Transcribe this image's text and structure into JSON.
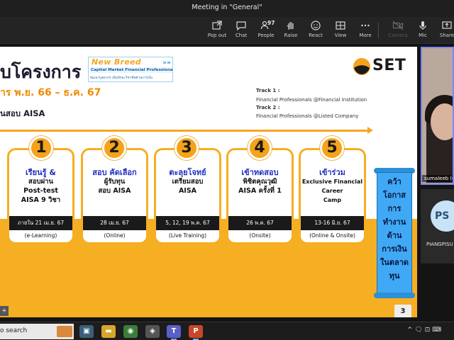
{
  "window": {
    "title": "Meeting in \"General\""
  },
  "toolbar": {
    "popout": "Pop out",
    "chat": "Chat",
    "people": "People",
    "people_count": "97",
    "raise": "Raise",
    "react": "React",
    "view": "View",
    "more": "More",
    "camera": "Camera",
    "mic": "Mic",
    "share": "Share"
  },
  "slide": {
    "title": "บโครงการ",
    "period": "าร พ.ย. 66 – ธ.ค. 67",
    "subtitle": "นสอบ AISA",
    "newbreed": {
      "title": "New Breed",
      "subtitle": "Capital Market Financial Professionals",
      "tagline": "พัฒนาบุคลากร เพิ่มทักษะวิชาชีพด้านการเงิน"
    },
    "set_logo": "SET",
    "track1_label": "Track 1 :",
    "track1_value": "Financial Professionals @Financial Institution",
    "track2_label": "Track 2 :",
    "track2_value": "Financial Professionals @Listed Company",
    "steps": [
      {
        "num": "1",
        "head": "เรียนรู้ &",
        "body": "สอบผ่าน\nPost-test\nAISA 9 วิชา",
        "date": "ภายใน 21 เม.ย. 67",
        "mode": "(e-Learning)"
      },
      {
        "num": "2",
        "head": "สอบ คัดเลือก",
        "body": "ผู้รับทุน\nสอบ AISA",
        "date": "28 เม.ย. 67",
        "mode": "(Online)"
      },
      {
        "num": "3",
        "head": "ตะลุยโจทย์",
        "body": "เตรียมสอบ\nAISA",
        "date": "5, 12, 19 พ.ค. 67",
        "mode": "(Live Training)"
      },
      {
        "num": "4",
        "head": "เข้าทดสอบ",
        "body": "พิชิตคุณวุฒิ\nAISA ครั้งที่ 1",
        "date": "26 พ.ค. 67",
        "mode": "(Onsite)"
      },
      {
        "num": "5",
        "head": "เข้าร่วม",
        "body": "Exclusive Financial\nCareer\nCamp",
        "date": "13-16 มิ.ย. 67",
        "mode": "(Online & Onsite)"
      }
    ],
    "banner": "คว้า\nโอกาส\nการ\nทำงาน\nด้าน\nการเงิน\nในตลาด\nทุน",
    "page_number": "3"
  },
  "participants": {
    "video_name": "sumaleeb (G",
    "avatar_initials": "PS",
    "avatar_name": "PIANGPISU"
  },
  "taskbar": {
    "search": "o search",
    "tray_time": "^ 🗨 ⊡ ⌨"
  }
}
